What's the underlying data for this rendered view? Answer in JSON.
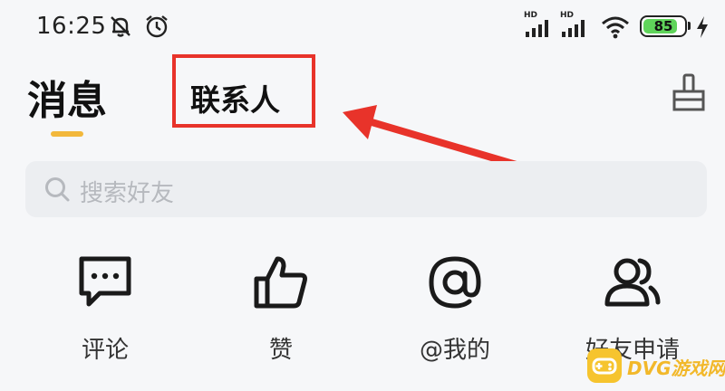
{
  "status_bar": {
    "time": "16:25",
    "signal1_label": "HD",
    "signal2_label": "HD",
    "battery_level": "85",
    "battery_percent": 85,
    "icons": [
      "bell-off-icon",
      "alarm-icon",
      "signal-icon",
      "signal-icon",
      "wifi-icon",
      "battery-icon",
      "charging-icon"
    ]
  },
  "header": {
    "tab_messages": "消息",
    "tab_contacts": "联系人",
    "clear_icon": "broom-icon",
    "active_color": "#f2b83b",
    "highlight_color": "#e8332a"
  },
  "search": {
    "placeholder": "搜索好友"
  },
  "shortcuts": [
    {
      "label": "评论",
      "icon": "comment-icon"
    },
    {
      "label": "赞",
      "icon": "thumbs-up-icon"
    },
    {
      "label": "@我的",
      "icon": "at-icon"
    },
    {
      "label": "好友申请",
      "icon": "friend-request-icon"
    }
  ],
  "watermark": {
    "text": "DVG游戏网"
  }
}
